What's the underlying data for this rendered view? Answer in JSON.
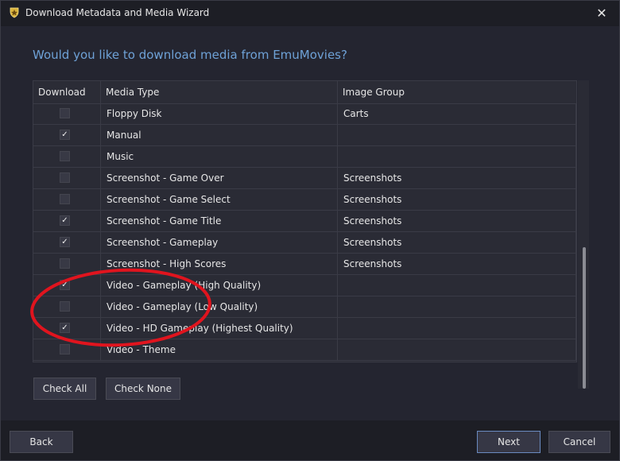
{
  "window": {
    "title": "Download Metadata and Media Wizard",
    "close_glyph": "✕",
    "app_icon": "trophy-shield-icon"
  },
  "heading": "Would you like to download media from EmuMovies?",
  "table": {
    "columns": [
      "Download",
      "Media Type",
      "Image Group"
    ],
    "rows": [
      {
        "checked": false,
        "check_glyph": "",
        "media_type": "Floppy Disk",
        "image_group": "Carts"
      },
      {
        "checked": true,
        "check_glyph": "✓",
        "media_type": "Manual",
        "image_group": ""
      },
      {
        "checked": false,
        "check_glyph": "",
        "media_type": "Music",
        "image_group": ""
      },
      {
        "checked": false,
        "check_glyph": "",
        "media_type": "Screenshot - Game Over",
        "image_group": "Screenshots"
      },
      {
        "checked": false,
        "check_glyph": "",
        "media_type": "Screenshot - Game Select",
        "image_group": "Screenshots"
      },
      {
        "checked": true,
        "check_glyph": "✓",
        "media_type": "Screenshot - Game Title",
        "image_group": "Screenshots"
      },
      {
        "checked": true,
        "check_glyph": "✓",
        "media_type": "Screenshot - Gameplay",
        "image_group": "Screenshots"
      },
      {
        "checked": false,
        "check_glyph": "",
        "media_type": "Screenshot - High Scores",
        "image_group": "Screenshots"
      },
      {
        "checked": true,
        "check_glyph": "✓",
        "media_type": "Video - Gameplay (High Quality)",
        "image_group": ""
      },
      {
        "checked": false,
        "check_glyph": "",
        "media_type": "Video - Gameplay (Low Quality)",
        "image_group": ""
      },
      {
        "checked": true,
        "check_glyph": "✓",
        "media_type": "Video - HD Gameplay (Highest Quality)",
        "image_group": ""
      },
      {
        "checked": false,
        "check_glyph": "",
        "media_type": "Video - Theme",
        "image_group": ""
      }
    ]
  },
  "buttons": {
    "check_all": "Check All",
    "check_none": "Check None",
    "back": "Back",
    "next": "Next",
    "cancel": "Cancel"
  },
  "colors": {
    "heading": "#6ea1d6",
    "annotation": "#e0141e",
    "next_border": "#6a8bc0"
  }
}
